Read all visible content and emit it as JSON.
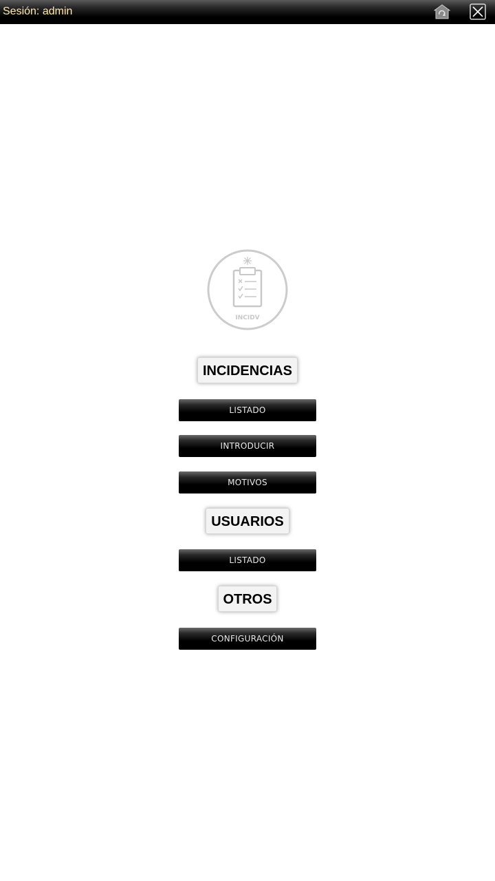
{
  "topbar": {
    "session_label": "Sesión: admin",
    "icons": [
      "refresh-home-icon",
      "close-icon"
    ]
  },
  "logo": {
    "text": "INCIDV",
    "color": "#c8c8c8"
  },
  "sections": {
    "incidencias": {
      "title": "INCIDENCIAS",
      "items": [
        "LISTADO",
        "INTRODUCIR",
        "MOTIVOS"
      ]
    },
    "usuarios": {
      "title": "USUARIOS",
      "items": [
        "LISTADO"
      ]
    },
    "otros": {
      "title": "OTROS",
      "items": [
        "CONFIGURACIÓN"
      ]
    }
  },
  "colors": {
    "topbar": "#000000",
    "session_text": "#ffe9b0",
    "button_bg": "#000000",
    "button_text": "#e8e8e8"
  }
}
